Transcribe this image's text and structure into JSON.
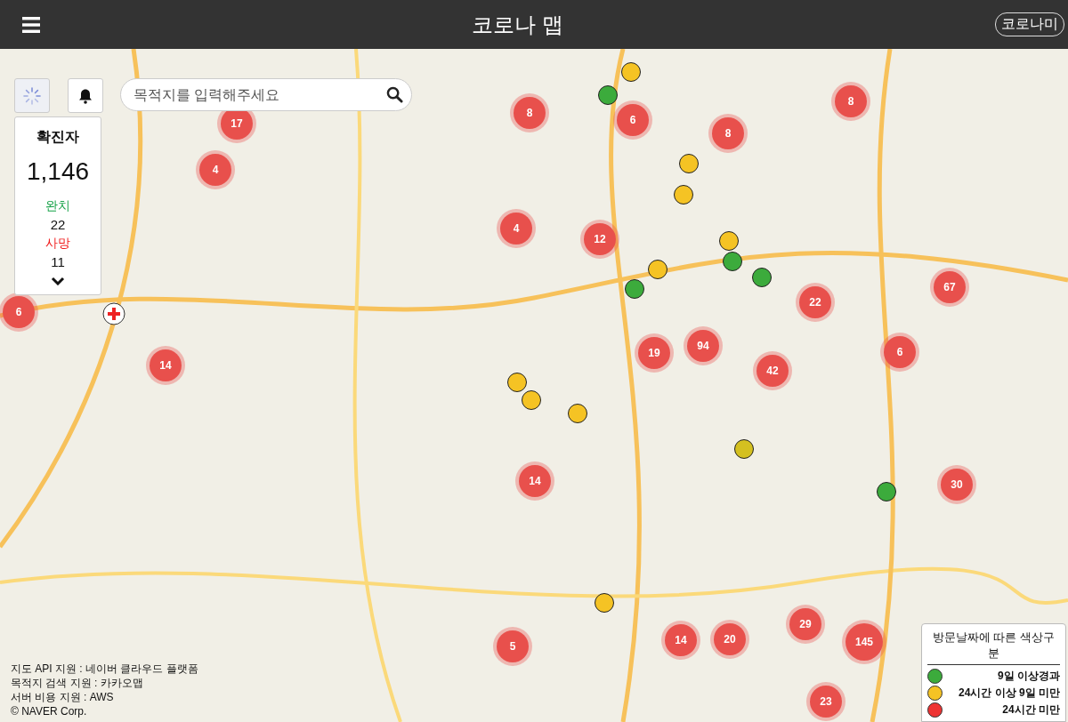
{
  "header": {
    "title": "코로나 맵",
    "user_button": "코로나미"
  },
  "search": {
    "placeholder": "목적지를 입력해주세요"
  },
  "stats": {
    "title": "확진자",
    "total": "1,146",
    "recovered_label": "완치",
    "recovered": "22",
    "deaths_label": "사망",
    "deaths": "11"
  },
  "clusters": [
    {
      "count": "17"
    },
    {
      "count": "4"
    },
    {
      "count": "8"
    },
    {
      "count": "6"
    },
    {
      "count": "8"
    },
    {
      "count": "8"
    },
    {
      "count": "4"
    },
    {
      "count": "12"
    },
    {
      "count": "67"
    },
    {
      "count": "22"
    },
    {
      "count": "6"
    },
    {
      "count": "19"
    },
    {
      "count": "94"
    },
    {
      "count": "42"
    },
    {
      "count": "6"
    },
    {
      "count": "14"
    },
    {
      "count": "14"
    },
    {
      "count": "30"
    },
    {
      "count": "29"
    },
    {
      "count": "14"
    },
    {
      "count": "20"
    },
    {
      "count": "145"
    },
    {
      "count": "5"
    },
    {
      "count": "23"
    }
  ],
  "visit_points": [
    {
      "color": "#f5c324"
    },
    {
      "color": "#3cab3c"
    },
    {
      "color": "#f5c324"
    },
    {
      "color": "#f5c324"
    },
    {
      "color": "#f5c324"
    },
    {
      "color": "#3cab3c"
    },
    {
      "color": "#f5c324"
    },
    {
      "color": "#3cab3c"
    },
    {
      "color": "#3cab3c"
    },
    {
      "color": "#f5c324"
    },
    {
      "color": "#f5c324"
    },
    {
      "color": "#f5c324"
    },
    {
      "color": "#d4c020"
    },
    {
      "color": "#3cab3c"
    },
    {
      "color": "#f5c324"
    }
  ],
  "credits": [
    "지도 API 지원 : 네이버 클라우드 플랫폼",
    "목적지 검색 지원 : 카카오맵",
    "서버 비용 지원 : AWS",
    "© NAVER Corp."
  ],
  "legend": {
    "title": "방문날짜에 따른 색상구분",
    "items": [
      {
        "label": "9일 이상경과",
        "color": "#3cab3c"
      },
      {
        "label": "24시간 이상 9일 미만",
        "color": "#f5c324"
      },
      {
        "label": "24시간 미만",
        "color": "#ee3333"
      }
    ]
  }
}
